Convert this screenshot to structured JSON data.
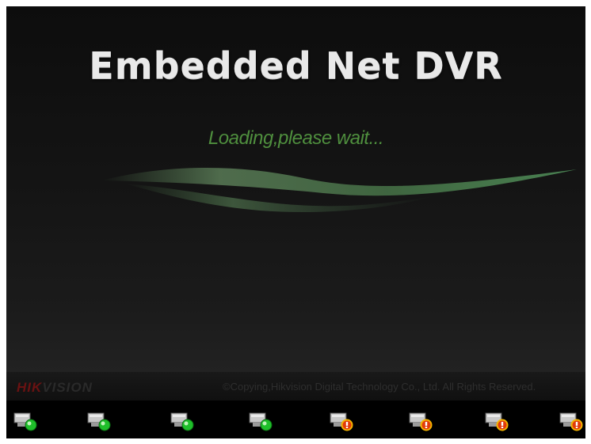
{
  "app": {
    "title": "Embedded Net DVR",
    "status_message": "Loading,please wait..."
  },
  "footer": {
    "brand_hik": "HIK",
    "brand_vision": "VISION",
    "copyright": "©Copying,Hikvision Digital Technology Co., Ltd. All Rights Reserved."
  },
  "status_icons": [
    {
      "name": "hdd-ok-icon",
      "state": "ok"
    },
    {
      "name": "hdd-ok-icon",
      "state": "ok"
    },
    {
      "name": "hdd-ok-icon",
      "state": "ok"
    },
    {
      "name": "hdd-ok-icon",
      "state": "ok"
    },
    {
      "name": "hdd-error-icon",
      "state": "error"
    },
    {
      "name": "hdd-error-icon",
      "state": "error"
    },
    {
      "name": "hdd-error-icon",
      "state": "error"
    },
    {
      "name": "hdd-error-icon",
      "state": "error"
    }
  ],
  "colors": {
    "status_ok": "#1fbf2a",
    "status_error": "#e23a0c",
    "status_error_ring": "#f5b400",
    "loading_text": "#4f8f3e"
  }
}
